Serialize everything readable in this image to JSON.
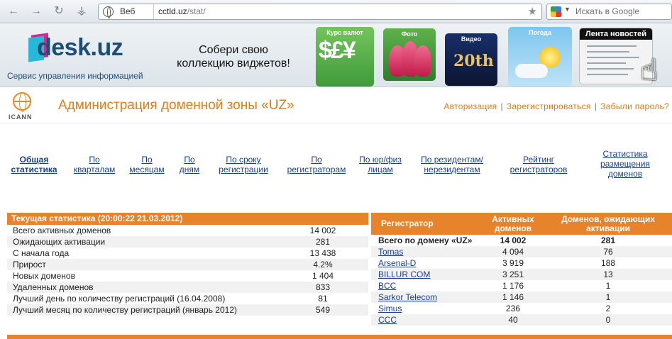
{
  "browser": {
    "search_engine_label": "Веб",
    "url_host": "cctld.uz",
    "url_path": "/stat/",
    "search_placeholder": "Искать в Google"
  },
  "banner": {
    "logo_text": "desk.uz",
    "tagline": "Сервис управления информацией",
    "slogan_line1": "Собери свою",
    "slogan_line2": "коллекцию виджетов!",
    "tiles": {
      "currency": "Курс валют",
      "currency_symbols": "$£¥",
      "photo": "Фото",
      "video": "Видео",
      "video_logo": "20th",
      "weather": "Погода",
      "news": "Лента новостей"
    }
  },
  "site": {
    "icann": "ICANN",
    "title": "Администрация доменной зоны «UZ»",
    "links": [
      "Авторизация",
      "Зарегистрироваться",
      "Забыли пароль?"
    ]
  },
  "tabs": [
    [
      "Общая",
      "статистика"
    ],
    [
      "По",
      "кварталам"
    ],
    [
      "По",
      "месяцам"
    ],
    [
      "По",
      "дням"
    ],
    [
      "По сроку",
      "регистрации"
    ],
    [
      "По",
      "регистраторам"
    ],
    [
      "По юр/физ",
      "лицам"
    ],
    [
      "По резидентам/",
      "нерезидентам"
    ],
    [
      "Рейтинг",
      "регистраторов"
    ],
    [
      "Статистика",
      "размещения",
      "доменов"
    ]
  ],
  "current_stats": {
    "header": "Текущая статистика (20:00:22 21.03.2012)",
    "rows": [
      {
        "label": "Всего активных доменов",
        "value": "14 002"
      },
      {
        "label": "Ожидающих активации",
        "value": "281"
      },
      {
        "label": "С начала года",
        "value": "13 438"
      },
      {
        "label": "Прирост",
        "value": "4.2%"
      },
      {
        "label": "Новых доменов",
        "value": "1 404"
      },
      {
        "label": "Удаленных доменов",
        "value": "833"
      },
      {
        "label": "Лучший день по количеству регистраций (16.04.2008)",
        "value": "81"
      },
      {
        "label": "Лучший месяц по количеству регистраций (январь 2012)",
        "value": "549"
      }
    ]
  },
  "registrars": {
    "col_registrar": "Регистратор",
    "col_active_1": "Активных",
    "col_active_2": "доменов",
    "col_pending_1": "Доменов, ожидающих",
    "col_pending_2": "активации",
    "total": {
      "name": "Всего по домену «UZ»",
      "active": "14 002",
      "pending": "281"
    },
    "rows": [
      {
        "name": "Tomas",
        "active": "4 094",
        "pending": "76"
      },
      {
        "name": "Arsenal-D",
        "active": "3 919",
        "pending": "188"
      },
      {
        "name": "BILLUR COM",
        "active": "3 251",
        "pending": "13"
      },
      {
        "name": "BCC",
        "active": "1 176",
        "pending": "1"
      },
      {
        "name": "Sarkor Telecom",
        "active": "1 146",
        "pending": "1"
      },
      {
        "name": "Simus",
        "active": "236",
        "pending": "2"
      },
      {
        "name": "CCC",
        "active": "40",
        "pending": "0"
      }
    ]
  }
}
